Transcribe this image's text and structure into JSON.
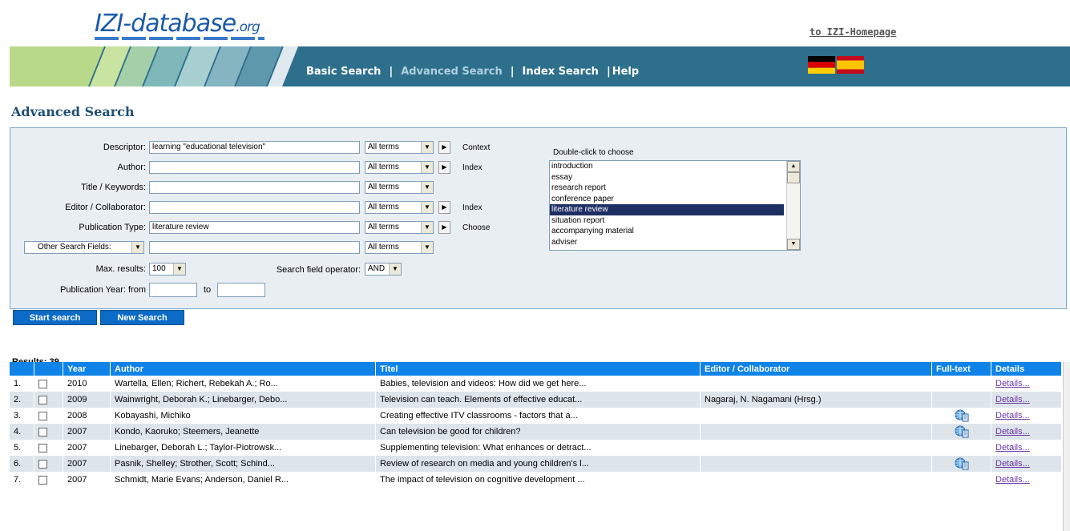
{
  "header": {
    "logo_main": "IZI-database",
    "logo_tld": ".org",
    "home_link": "to IZI-Homepage"
  },
  "nav": {
    "basic": "Basic Search",
    "advanced": "Advanced Search",
    "index": "Index Search",
    "help": "Help",
    "sep": "|"
  },
  "page_title": "Advanced Search",
  "form": {
    "descriptor_label": "Descriptor:",
    "descriptor_value": "learning \"educational television\"",
    "author_label": "Author:",
    "author_value": "",
    "title_label": "Title / Keywords:",
    "title_value": "",
    "editor_label": "Editor / Collaborator:",
    "editor_value": "",
    "pubtype_label": "Publication Type:",
    "pubtype_value": "literature review",
    "other_fields": "Other Search Fields:",
    "other_value": "",
    "terms_option": "All terms",
    "context": "Context",
    "index": "Index",
    "choose": "Choose",
    "max_label": "Max. results:",
    "max_value": "100",
    "operator_label": "Search field operator:",
    "operator_value": "AND",
    "year_from_label": "Publication Year: from",
    "year_to_label": "to",
    "year_from": "",
    "year_to": "",
    "start": "Start search",
    "new": "New Search"
  },
  "chooser": {
    "caption": "Double-click to choose",
    "items": [
      "introduction",
      "essay",
      "research report",
      "conference paper",
      "literature review",
      "situation report",
      "accompanying material",
      "adviser"
    ],
    "selected": "literature review"
  },
  "results": {
    "label": "Results: 39",
    "headers": [
      "Year",
      "Author",
      "Titel",
      "Editor / Collaborator",
      "Full-text",
      "Details"
    ],
    "rows": [
      {
        "n": "1.",
        "year": "2010",
        "author": "Wartella, Ellen; Richert, Rebekah A.; Ro...",
        "title": "Babies, television and videos: How did we get here...",
        "editor": "",
        "fulltext": false,
        "details": "Details..."
      },
      {
        "n": "2.",
        "year": "2009",
        "author": "Wainwright, Deborah K.; Linebarger, Debo...",
        "title": "Television can teach. Elements of effective educat...",
        "editor": "Nagaraj, N. Nagamani (Hrsg.)",
        "fulltext": false,
        "details": "Details..."
      },
      {
        "n": "3.",
        "year": "2008",
        "author": "Kobayashi, Michiko",
        "title": "Creating effective ITV classrooms - factors that a...",
        "editor": "",
        "fulltext": true,
        "details": "Details..."
      },
      {
        "n": "4.",
        "year": "2007",
        "author": "Kondo, Kaoruko; Steemers, Jeanette",
        "title": "Can television be good for children?",
        "editor": "",
        "fulltext": true,
        "details": "Details..."
      },
      {
        "n": "5.",
        "year": "2007",
        "author": "Linebarger, Deborah L.; Taylor-Piotrowsk...",
        "title": "Supplementing television: What enhances or detract...",
        "editor": "",
        "fulltext": false,
        "details": "Details..."
      },
      {
        "n": "6.",
        "year": "2007",
        "author": "Pasnik, Shelley; Strother, Scott; Schind...",
        "title": "Review of research on media and young children's l...",
        "editor": "",
        "fulltext": true,
        "details": "Details..."
      },
      {
        "n": "7.",
        "year": "2007",
        "author": "Schmidt, Marie Evans; Anderson, Daniel R...",
        "title": "The impact of television on cognitive development ...",
        "editor": "",
        "fulltext": false,
        "details": "Details..."
      }
    ]
  },
  "colors": {
    "nav_bg": "#2e6f8c",
    "table_header": "#0f83e8",
    "button": "#0b6bc6",
    "title": "#1e4f74"
  }
}
